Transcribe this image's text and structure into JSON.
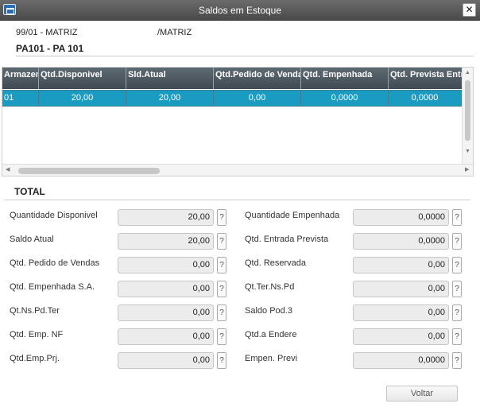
{
  "window": {
    "title": "Saldos em Estoque",
    "close_label": "✕"
  },
  "header": {
    "filial": "99/01 - MATRIZ",
    "filial_name": "/MATRIZ",
    "product": "PA101 - PA 101"
  },
  "grid": {
    "columns": [
      "Armazem",
      "Qtd.Disponivel",
      "Sld.Atual",
      "Qtd.Pedido de Vendas",
      "Qtd. Empenhada",
      "Qtd. Prevista Entrada"
    ],
    "rows": [
      [
        "01",
        "20,00",
        "20,00",
        "0,00",
        "0,0000",
        "0,0000"
      ]
    ]
  },
  "total": {
    "title": "TOTAL",
    "left": [
      {
        "label": "Quantidade Disponivel",
        "value": "20,00"
      },
      {
        "label": "Saldo Atual",
        "value": "20,00"
      },
      {
        "label": "Qtd. Pedido de Vendas",
        "value": "0,00"
      },
      {
        "label": "Qtd. Empenhada S.A.",
        "value": "0,00"
      },
      {
        "label": "Qt.Ns.Pd.Ter",
        "value": "0,00"
      },
      {
        "label": "Qtd. Emp. NF",
        "value": "0,00"
      },
      {
        "label": "Qtd.Emp.Prj.",
        "value": "0,00"
      }
    ],
    "right": [
      {
        "label": "Quantidade Empenhada",
        "value": "0,0000"
      },
      {
        "label": "Qtd. Entrada Prevista",
        "value": "0,0000"
      },
      {
        "label": "Qtd. Reservada",
        "value": "0,00"
      },
      {
        "label": "Qt.Ter.Ns.Pd",
        "value": "0,00"
      },
      {
        "label": "Saldo Pod.3",
        "value": "0,00"
      },
      {
        "label": "Qtd.a Endere",
        "value": "0,00"
      },
      {
        "label": "Empen. Previ",
        "value": "0,0000"
      }
    ],
    "help_label": "?"
  },
  "footer": {
    "voltar_label": "Voltar"
  }
}
